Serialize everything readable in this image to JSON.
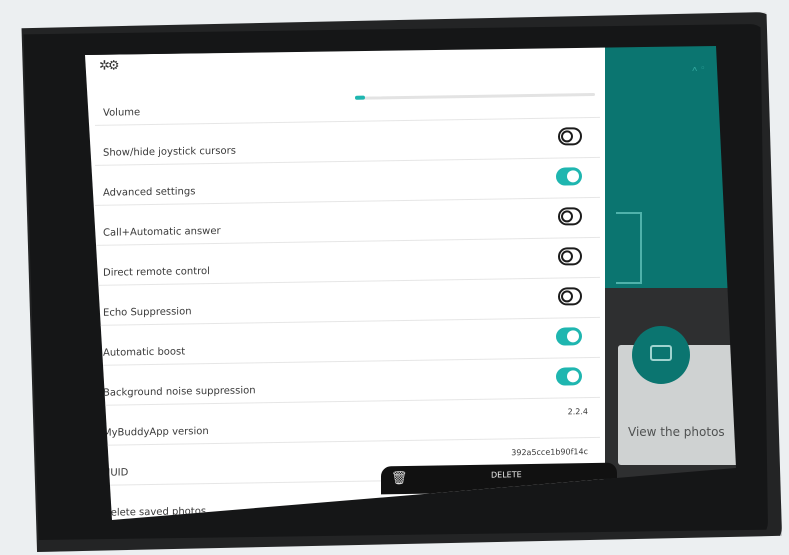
{
  "header": {
    "title": ""
  },
  "settings": {
    "volume": {
      "label": "Volume",
      "level": 0.04
    },
    "rows": [
      {
        "label": "Show/hide joystick cursors",
        "state": "off"
      },
      {
        "label": "Advanced settings",
        "state": "on"
      },
      {
        "label": "Call+Automatic answer",
        "state": "off"
      },
      {
        "label": "Direct remote control",
        "state": "off"
      },
      {
        "label": "Echo Suppression",
        "state": "off"
      },
      {
        "label": "Automatic boost",
        "state": "on"
      },
      {
        "label": "Background noise suppression",
        "state": "on"
      },
      {
        "label": "MyBuddyApp version",
        "value": "2.2.4"
      },
      {
        "label": "UUID",
        "value": "392a5cce1b90f14c"
      },
      {
        "label": "Delete saved photos"
      }
    ]
  },
  "snackbar": {
    "delete_label": "DELETE"
  },
  "background": {
    "view_photos_label": "View the photos",
    "status_text": "ߍ ◦"
  },
  "colors": {
    "accent": "#1fb6b0",
    "teal_bg": "#0b7570",
    "device": "#232425"
  },
  "icons": {
    "header": "settings-gears-icon",
    "snackbar": "trash-icon",
    "photo": "photo-icon"
  }
}
